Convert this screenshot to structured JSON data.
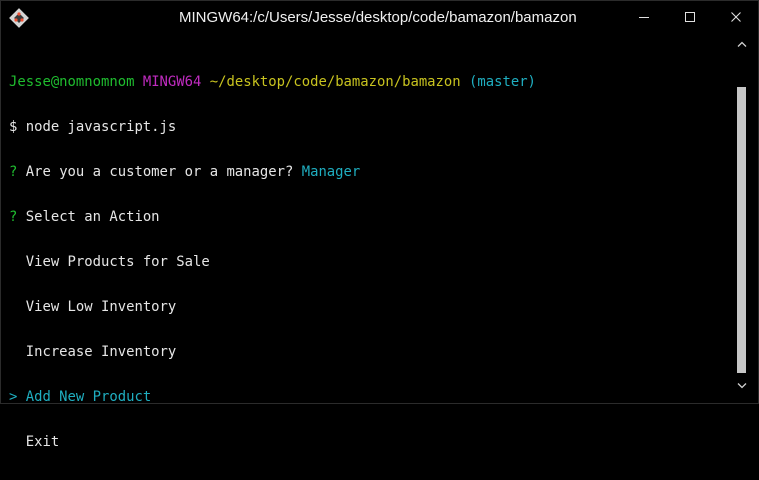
{
  "window": {
    "title": "MINGW64:/c/Users/Jesse/desktop/code/bamazon/bamazon",
    "icons": {
      "app": "git-bash-diamond-icon",
      "minimize": "minimize-icon",
      "maximize": "maximize-icon",
      "close": "close-icon"
    }
  },
  "colors": {
    "background": "#000000",
    "text": "#e6e6e6",
    "green": "#1fbd2f",
    "magenta": "#c02bc0",
    "yellow": "#c8c31f",
    "cyan": "#1faec0",
    "scrollbar_thumb": "#c6c6c6"
  },
  "terminal": {
    "prompt": {
      "user_host": "Jesse@nomnomnom",
      "env": "MINGW64",
      "path": "~/desktop/code/bamazon/bamazon",
      "branch": "(master)"
    },
    "command_line": "$ node javascript.js",
    "q1": {
      "mark": "?",
      "text": " Are you a customer or a manager? ",
      "answer": "Manager"
    },
    "q2": {
      "mark": "?",
      "text": " Select an Action"
    },
    "options": [
      {
        "prefix": "  ",
        "label": "View Products for Sale"
      },
      {
        "prefix": "  ",
        "label": "View Low Inventory"
      },
      {
        "prefix": "  ",
        "label": "Increase Inventory"
      },
      {
        "prefix": "> ",
        "label": "Add New Product",
        "selected": true
      },
      {
        "prefix": "  ",
        "label": "Exit"
      }
    ]
  }
}
